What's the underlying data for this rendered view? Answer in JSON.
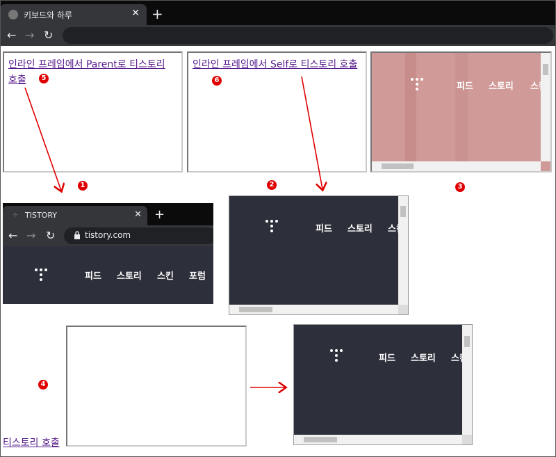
{
  "browser": {
    "tab_title": "키보드와 하루",
    "new_tab": "+",
    "close": "✕",
    "back": "←",
    "forward": "→",
    "reload": "↻"
  },
  "frame5": {
    "link": "인라인 프레임에서 Parent로 티스토리 호출",
    "badge": "5"
  },
  "frame6": {
    "link": "인라인 프레임에서 Self로 티스토리 호출",
    "badge": "6"
  },
  "badges": {
    "one": "1",
    "two": "2",
    "three": "3",
    "four": "4"
  },
  "tistory": {
    "nav": [
      "피드",
      "스토리",
      "스킨",
      "포럼"
    ],
    "tab_title": "TISTORY",
    "url": "tistory.com"
  },
  "bottom_link": "티스토리 호출",
  "colors": {
    "dark": "#2d303b",
    "pink": "#d09a98",
    "arrow": "#e00000",
    "badge": "#e00000"
  }
}
